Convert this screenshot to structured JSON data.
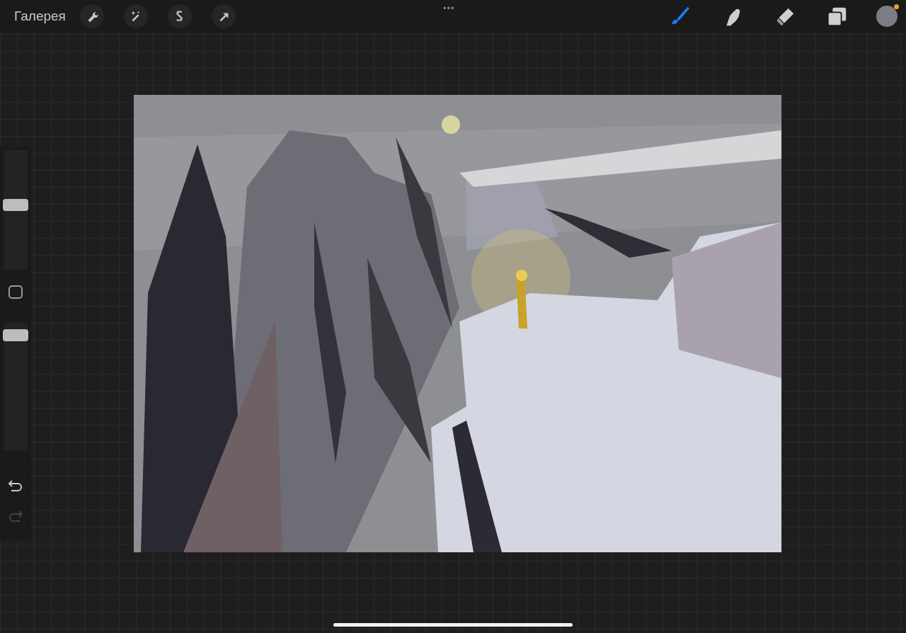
{
  "top_bar": {
    "gallery_label": "Галерея",
    "more_label": "•••",
    "actions": [
      {
        "kind": "wrench"
      },
      {
        "kind": "wand"
      },
      {
        "kind": "selection"
      },
      {
        "kind": "transform"
      }
    ],
    "tools": [
      {
        "kind": "brush",
        "selected": true
      },
      {
        "kind": "smudge",
        "selected": false
      },
      {
        "kind": "eraser",
        "selected": false
      },
      {
        "kind": "layers",
        "selected": false
      }
    ]
  },
  "sidebar": {
    "sliders": [
      {
        "kind": "size",
        "level": 0.54
      },
      {
        "kind": "opacity",
        "level": 0.9
      }
    ],
    "undo": {
      "disabled": false
    },
    "redo": {
      "disabled": true
    }
  }
}
